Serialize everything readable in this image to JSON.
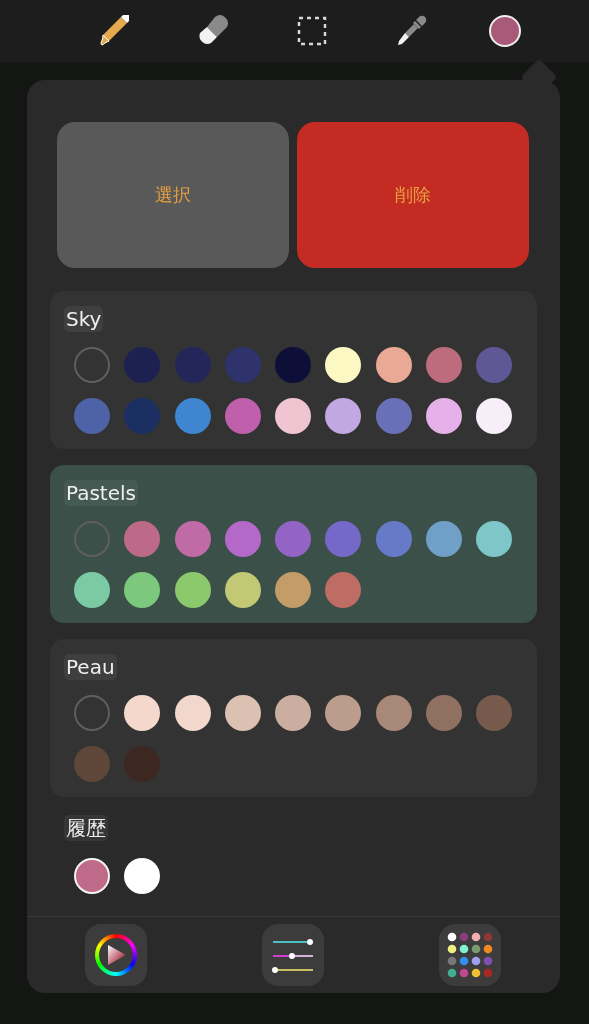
{
  "toolbar": {
    "tools": [
      {
        "kind": "brush",
        "selected": true
      },
      {
        "kind": "eraser",
        "selected": false
      },
      {
        "kind": "selection",
        "selected": false
      },
      {
        "kind": "eyedropper",
        "selected": false
      }
    ],
    "current_swatch": {
      "color": "#a85a78"
    }
  },
  "actions": [
    {
      "kind": "neutral",
      "label": "選択"
    },
    {
      "kind": "danger",
      "label": "削除"
    }
  ],
  "palettes": [
    {
      "name": "Sky",
      "selected": false,
      "swatches": [
        {
          "kind": "empty"
        },
        {
          "kind": "color",
          "color": "#1c2152"
        },
        {
          "kind": "color",
          "color": "#24265a"
        },
        {
          "kind": "color",
          "color": "#2e336e"
        },
        {
          "kind": "color",
          "color": "#0e0f38"
        },
        {
          "kind": "color",
          "color": "#fcf8c4"
        },
        {
          "kind": "color",
          "color": "#eaa994"
        },
        {
          "kind": "color",
          "color": "#bc6c7c"
        },
        {
          "kind": "color",
          "color": "#5f5896"
        },
        {
          "kind": "color",
          "color": "#4e62a8"
        },
        {
          "kind": "color",
          "color": "#1b2f62"
        },
        {
          "kind": "color",
          "color": "#3e86d0"
        },
        {
          "kind": "color",
          "color": "#c060ac"
        },
        {
          "kind": "color",
          "color": "#f0c4d0"
        },
        {
          "kind": "color",
          "color": "#c2a8e0"
        },
        {
          "kind": "color",
          "color": "#6a70b8"
        },
        {
          "kind": "color",
          "color": "#e6b0e8"
        },
        {
          "kind": "color",
          "color": "#f8eefa"
        }
      ]
    },
    {
      "name": "Pastels",
      "selected": true,
      "swatches": [
        {
          "kind": "empty"
        },
        {
          "kind": "color",
          "color": "#bc6a88"
        },
        {
          "kind": "color",
          "color": "#c06aa6"
        },
        {
          "kind": "color",
          "color": "#b468c8"
        },
        {
          "kind": "color",
          "color": "#9464c4"
        },
        {
          "kind": "color",
          "color": "#7668c8"
        },
        {
          "kind": "color",
          "color": "#667ac8"
        },
        {
          "kind": "color",
          "color": "#70a0c8"
        },
        {
          "kind": "color",
          "color": "#7ec6c8"
        },
        {
          "kind": "color",
          "color": "#7ccaa4"
        },
        {
          "kind": "color",
          "color": "#7cc87c"
        },
        {
          "kind": "color",
          "color": "#8cc86c"
        },
        {
          "kind": "color",
          "color": "#c2c874"
        },
        {
          "kind": "color",
          "color": "#c49c68"
        },
        {
          "kind": "color",
          "color": "#be6c64"
        }
      ]
    },
    {
      "name": "Peau",
      "selected": false,
      "swatches": [
        {
          "kind": "empty"
        },
        {
          "kind": "color",
          "color": "#f4d8cc"
        },
        {
          "kind": "color",
          "color": "#f2d8cc"
        },
        {
          "kind": "color",
          "color": "#dcc0b2"
        },
        {
          "kind": "color",
          "color": "#ccaea0"
        },
        {
          "kind": "color",
          "color": "#bc9c8c"
        },
        {
          "kind": "color",
          "color": "#a88878"
        },
        {
          "kind": "color",
          "color": "#907060"
        },
        {
          "kind": "color",
          "color": "#785a4c"
        },
        {
          "kind": "color",
          "color": "#5e4638"
        },
        {
          "kind": "color",
          "color": "#3c2820"
        }
      ]
    }
  ],
  "history": {
    "title": "履歴",
    "swatches": [
      {
        "color": "#be6a88",
        "selected": true
      },
      {
        "color": "#ffffff",
        "selected": false
      }
    ]
  },
  "footer": {
    "tabs": [
      {
        "kind": "disc"
      },
      {
        "kind": "sliders"
      },
      {
        "kind": "palettes"
      }
    ]
  }
}
